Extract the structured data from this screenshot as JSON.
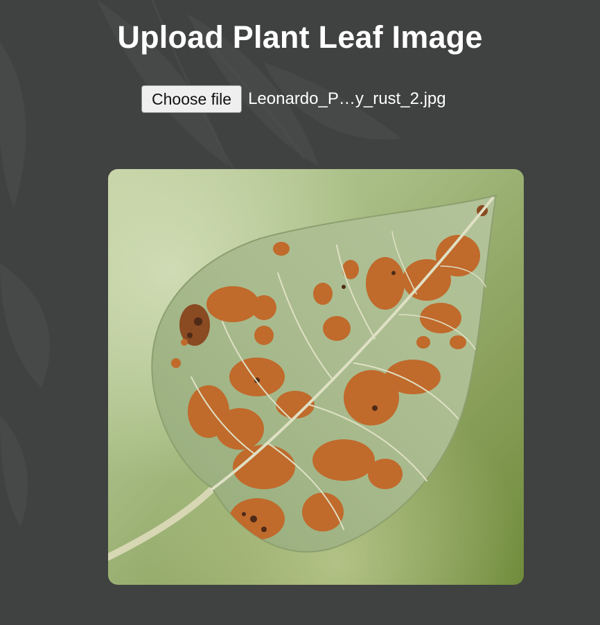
{
  "page": {
    "title": "Upload Plant Leaf Image"
  },
  "file_input": {
    "button_label": "Choose file",
    "selected_file": "Leonardo_P…y_rust_2.jpg"
  },
  "preview": {
    "subject": "leaf-with-rust-spots-image"
  },
  "colors": {
    "background": "#404141",
    "title_text": "#ffffff",
    "leaf_green": "#a3b68a",
    "rust_spot": "#c06a2c"
  }
}
